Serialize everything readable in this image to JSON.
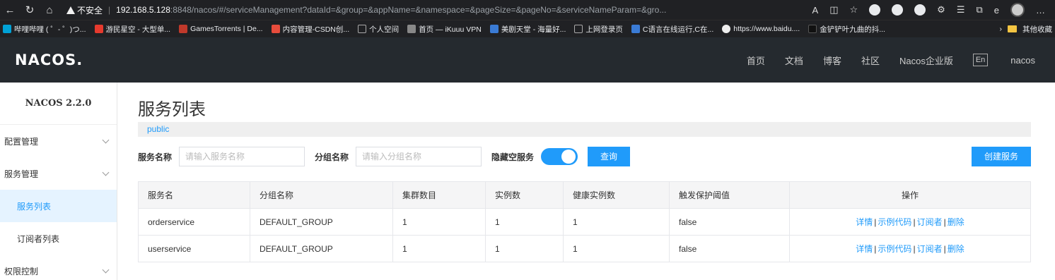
{
  "browser": {
    "security_label": "不安全",
    "url_host": "192.168.5.128",
    "url_rest": ":8848/nacos/#/serviceManagement?dataId=&group=&appName=&namespace=&pageSize=&pageNo=&serviceNameParam=&gro..."
  },
  "bookmarks": [
    {
      "label": "哔哩哔哩 ( ゜- ゜)つ...",
      "color": "#00a1d6"
    },
    {
      "label": "游民星空 - 大型单...",
      "color": "#e63a2e"
    },
    {
      "label": "GamesTorrents | De...",
      "color": "#c0392b"
    },
    {
      "label": "内容管理-CSDN创...",
      "color": "#e74c3c"
    },
    {
      "label": "个人空间",
      "color": "#888888"
    },
    {
      "label": "首页 — iKuuu VPN",
      "color": "#888888"
    },
    {
      "label": "美剧天堂 - 海量好...",
      "color": "#3a7bd5"
    },
    {
      "label": "上网登录页",
      "color": "#888888"
    },
    {
      "label": "C语言在线运行,C在...",
      "color": "#3a7bd5"
    },
    {
      "label": "https://www.baidu....",
      "color": "#eeeeee"
    },
    {
      "label": "金铲铲叶九曲的抖...",
      "color": "#111111"
    }
  ],
  "bookmarks_other": "其他收藏",
  "header": {
    "logo": "NACOS.",
    "nav": [
      "首页",
      "文档",
      "博客",
      "社区",
      "Nacos企业版"
    ],
    "lang": "En",
    "user": "nacos"
  },
  "sidebar": {
    "version": "NACOS 2.2.0",
    "menu": {
      "config": "配置管理",
      "service": "服务管理",
      "service_list": "服务列表",
      "subscribers": "订阅者列表",
      "auth": "权限控制"
    }
  },
  "main": {
    "title": "服务列表",
    "namespace": "public",
    "filters": {
      "service_name_label": "服务名称",
      "service_name_placeholder": "请输入服务名称",
      "group_name_label": "分组名称",
      "group_name_placeholder": "请输入分组名称",
      "hide_empty_label": "隐藏空服务",
      "hide_empty_on": true,
      "query_button": "查询",
      "create_button": "创建服务"
    },
    "table": {
      "headers": [
        "服务名",
        "分组名称",
        "集群数目",
        "实例数",
        "健康实例数",
        "触发保护阈值",
        "操作"
      ],
      "rows": [
        [
          "orderservice",
          "DEFAULT_GROUP",
          "1",
          "1",
          "1",
          "false"
        ],
        [
          "userservice",
          "DEFAULT_GROUP",
          "1",
          "1",
          "1",
          "false"
        ]
      ],
      "actions": [
        "详情",
        "示例代码",
        "订阅者",
        "删除"
      ]
    }
  }
}
